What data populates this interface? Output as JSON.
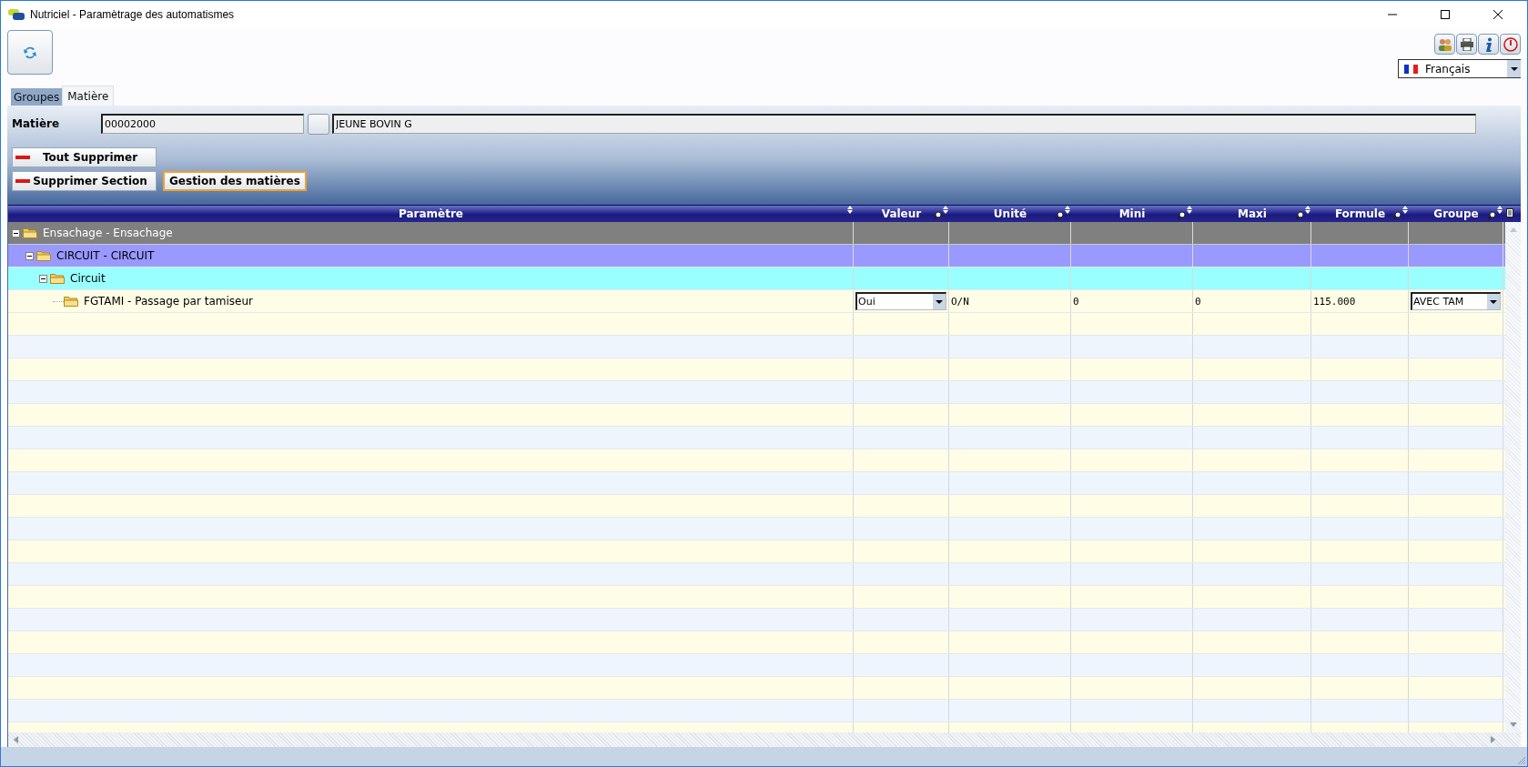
{
  "window": {
    "title": "Nutriciel - Paramètrage des automatismes"
  },
  "language": {
    "value": "Français"
  },
  "tabs": [
    {
      "label": "Groupes",
      "selected": false
    },
    {
      "label": "Matière",
      "selected": true
    }
  ],
  "matiere": {
    "label": "Matière",
    "code": "00002000",
    "name": "JEUNE BOVIN G"
  },
  "button_rows": [
    [
      {
        "label": "Tout Supprimer",
        "kind": "remove",
        "focused": false
      }
    ],
    [
      {
        "label": "Supprimer Section",
        "kind": "remove",
        "focused": false
      },
      {
        "label": "Gestion des matières",
        "kind": "manage",
        "focused": true
      }
    ]
  ],
  "grid": {
    "columns": [
      "Paramètre",
      "Valeur",
      "Unité",
      "Mini",
      "Maxi",
      "Formule",
      "Groupe"
    ],
    "rows": [
      {
        "label": "Ensachage - Ensachage",
        "expanded": true,
        "children": [
          {
            "label": "CIRCUIT - CIRCUIT",
            "expanded": true,
            "children": [
              {
                "label": "Circuit",
                "expanded": true,
                "children": [
                  {
                    "label": "FGTAMI - Passage par tamiseur",
                    "cells": [
                      {
                        "kind": "dropdown",
                        "value": "Oui"
                      },
                      {
                        "kind": "text",
                        "value": "O/N"
                      },
                      {
                        "kind": "text",
                        "value": "0"
                      },
                      {
                        "kind": "text",
                        "value": "0"
                      },
                      {
                        "kind": "text",
                        "value": "115.000"
                      },
                      {
                        "kind": "dropdown",
                        "value": "AVEC TAM"
                      }
                    ]
                  }
                ]
              }
            ]
          }
        ]
      }
    ]
  }
}
